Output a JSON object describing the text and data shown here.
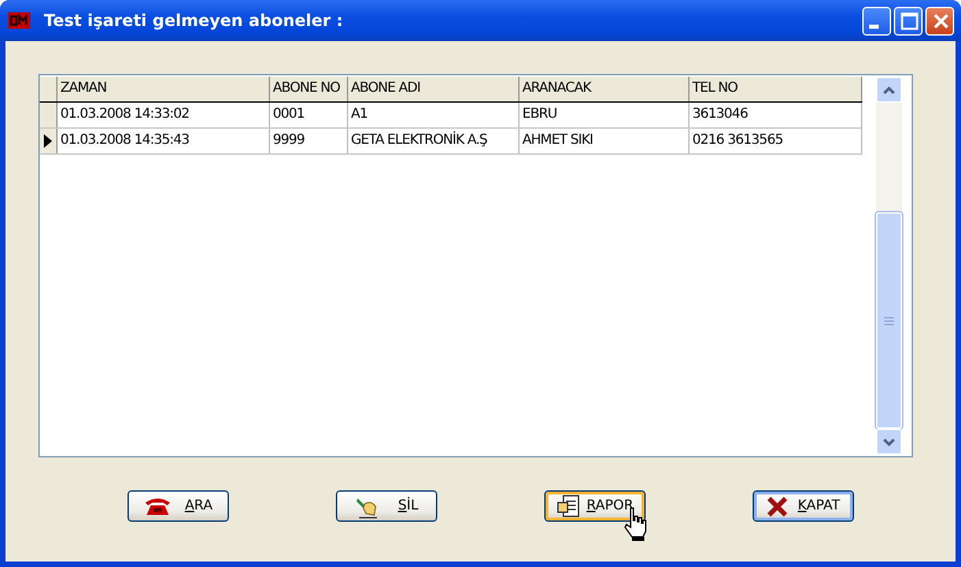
{
  "window": {
    "title": "Test işareti gelmeyen aboneler :"
  },
  "table": {
    "columns": [
      "ZAMAN",
      "ABONE NO",
      "ABONE ADI",
      "ARANACAK",
      "TEL NO"
    ],
    "rows": [
      {
        "current": false,
        "cells": [
          "01.03.2008 14:33:02",
          "0001",
          "A1",
          "EBRU",
          "3613046"
        ]
      },
      {
        "current": true,
        "cells": [
          "01.03.2008 14:35:43",
          "9999",
          "GETA ELEKTRONİK A.Ş",
          "AHMET SIKI",
          "0216 3613565"
        ]
      }
    ]
  },
  "buttons": [
    {
      "kind": "phone",
      "label": "ARA",
      "hover": false,
      "default": false
    },
    {
      "kind": "pen",
      "label": "SİL",
      "hover": false,
      "default": false
    },
    {
      "kind": "report",
      "label": "RAPOR",
      "hover": true,
      "default": false
    },
    {
      "kind": "close",
      "label": "KAPAT",
      "hover": false,
      "default": true
    }
  ]
}
